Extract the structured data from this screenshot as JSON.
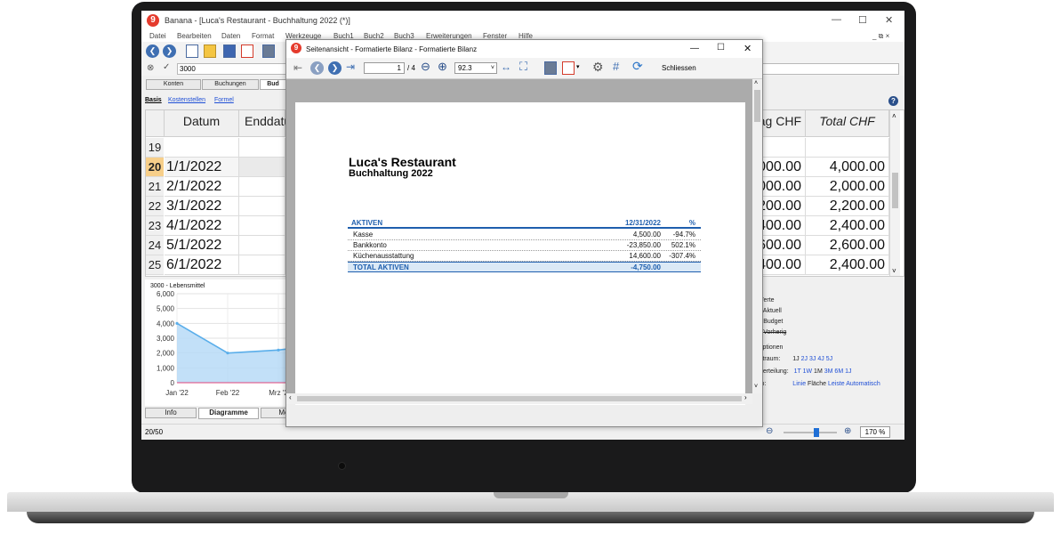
{
  "app": {
    "title": "Banana - [Luca's Restaurant - Buchhaltung 2022 (*)]",
    "logo": "9",
    "menu": [
      "Datei",
      "Bearbeiten",
      "Daten",
      "Format",
      "Werkzeuge",
      "Buch1",
      "Buch2",
      "Buch3",
      "Erweiterungen",
      "Fenster",
      "Hilfe"
    ],
    "cell_value": "3000",
    "tabs": [
      "Konten",
      "Buchungen",
      "Bud"
    ],
    "subtabs": [
      "Basis",
      "Kostenstellen",
      "Formel"
    ],
    "columns": [
      "Datum",
      "Enddatu",
      "ag CHF",
      "Total CHF"
    ],
    "rows": [
      {
        "num": "19",
        "date": "",
        "amount": "",
        "total": ""
      },
      {
        "num": "20",
        "date": "1/1/2022",
        "amount": "000.00",
        "total": "4,000.00"
      },
      {
        "num": "21",
        "date": "2/1/2022",
        "amount": "000.00",
        "total": "2,000.00"
      },
      {
        "num": "22",
        "date": "3/1/2022",
        "amount": "200.00",
        "total": "2,200.00"
      },
      {
        "num": "23",
        "date": "4/1/2022",
        "amount": "400.00",
        "total": "2,400.00"
      },
      {
        "num": "24",
        "date": "5/1/2022",
        "amount": "600.00",
        "total": "2,600.00"
      },
      {
        "num": "25",
        "date": "6/1/2022",
        "amount": "400.00",
        "total": "2,400.00"
      }
    ],
    "chart_title": "3000 - Lebensmittel",
    "right_panel": {
      "werte": "Werte",
      "aktuell": "Aktuell",
      "budget": "Budget",
      "vorherig": "Vorherig",
      "optionen": "Optionen",
      "zeitraum_label": "eitraum:",
      "zeitraum_opts": [
        "1J",
        "2J",
        "3J",
        "4J",
        "5J"
      ],
      "unterteilung_label": "nterteilung:",
      "unterteilung_opts": [
        "1T",
        "1W",
        "1M",
        "3M",
        "6M",
        "1J"
      ],
      "typ_label": "yp:",
      "typ_opts": [
        "Linie",
        "Fläche",
        "Leiste",
        "Automatisch"
      ]
    },
    "bottom_tabs": [
      "Info",
      "Diagramme",
      "Meld"
    ],
    "status_left": "20/50",
    "zoom": "170 %"
  },
  "chart_data": {
    "type": "area",
    "title": "3000 - Lebensmittel",
    "categories": [
      "Jan '22",
      "Feb '22",
      "Mrz '2"
    ],
    "series": [
      {
        "values": [
          4000,
          2000,
          2200
        ]
      }
    ],
    "yticks": [
      "6,000",
      "5,000",
      "4,000",
      "3,000",
      "2,000",
      "1,000",
      "0"
    ],
    "ylim": [
      0,
      6000
    ],
    "grid": true,
    "colors": {
      "fill": "#b7dbf7",
      "line": "#5aaeea"
    }
  },
  "preview": {
    "title": "Seitenansicht - Formatierte Bilanz - Formatierte Bilanz",
    "page_input": "1",
    "page_total": "/ 4",
    "zoom_value": "92.3",
    "close_label": "Schliessen",
    "company": "Luca's Restaurant",
    "subtitle": "Buchhaltung 2022",
    "report": {
      "header": {
        "label": "AKTIVEN",
        "date": "12/31/2022",
        "pct": "%"
      },
      "rows": [
        {
          "label": "Kasse",
          "value": "4,500.00",
          "pct": "-94.7%"
        },
        {
          "label": "Bankkonto",
          "value": "-23,850.00",
          "pct": "502.1%"
        },
        {
          "label": "Küchenausstattung",
          "value": "14,600.00",
          "pct": "-307.4%"
        }
      ],
      "total": {
        "label": "TOTAL AKTIVEN",
        "value": "-4,750.00"
      }
    }
  }
}
